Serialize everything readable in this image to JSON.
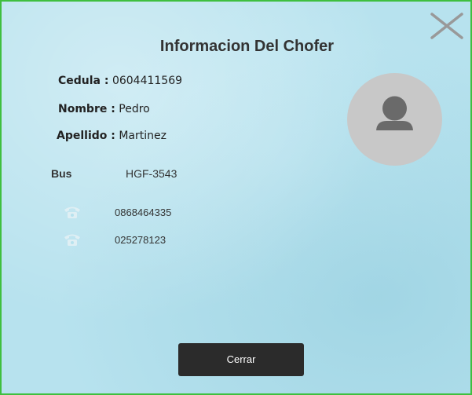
{
  "dialog": {
    "title": "Informacion Del Chofer"
  },
  "driver": {
    "cedula_label": "Cedula :",
    "cedula_value": "0604411569",
    "nombre_label": "Nombre :",
    "nombre_value": "Pedro",
    "apellido_label": "Apellido :",
    "apellido_value": "Martinez"
  },
  "bus": {
    "label": "Bus",
    "value": "HGF-3543"
  },
  "phones": [
    {
      "icon": "telephone-icon",
      "value": "0868464335"
    },
    {
      "icon": "telephone-icon",
      "value": "025278123"
    }
  ],
  "avatar": {
    "icon": "user-silhouette-icon"
  },
  "footer": {
    "close_label": "Cerrar"
  },
  "colors": {
    "background": "#b7e2ee",
    "border": "#3fbf3f",
    "button": "#2b2b2b",
    "avatar_bg": "#c8c8c8",
    "avatar_fg": "#6a6a6a"
  }
}
